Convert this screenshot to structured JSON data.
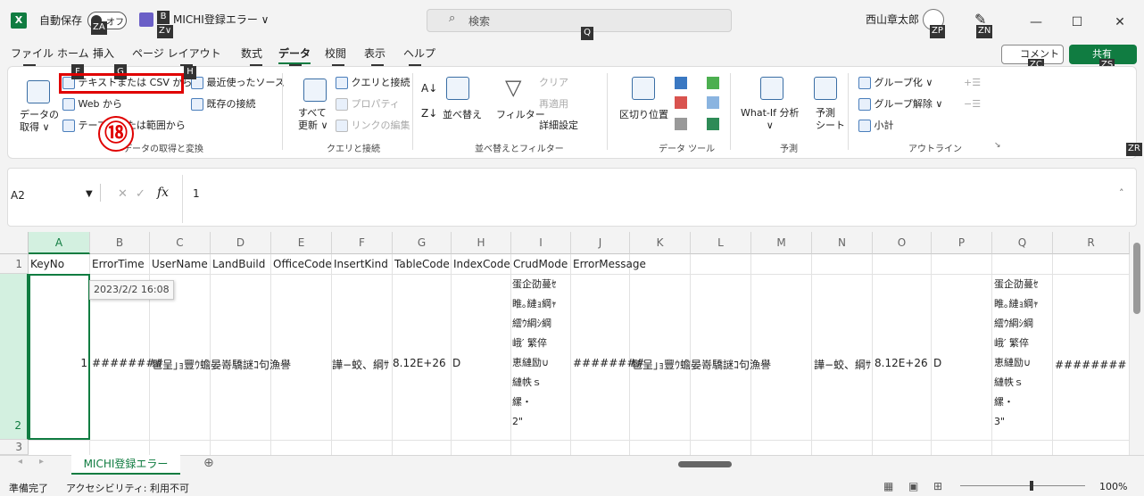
{
  "titlebar": {
    "excel_icon": "X",
    "autosave_label": "自動保存",
    "autosave_state": "オフ",
    "doc_title": "MICHI登録エラー ∨",
    "search_placeholder": "検索",
    "user_name": "西山章太郎",
    "keytips": {
      "autosave": "ZA",
      "save": "B",
      "save_sub": "Z∨",
      "search": "Q",
      "profile": "ZP",
      "pen": "ZN",
      "comment": "ZC",
      "share": "ZS",
      "ribbon_options": "ZR"
    },
    "minimize": "—",
    "maximize": "☐",
    "close": "✕"
  },
  "menu": {
    "tabs": [
      "ファイル",
      "ホーム",
      "挿入",
      "ページ レイアウト",
      "数式",
      "データ",
      "校閲",
      "表示",
      "ヘルプ"
    ],
    "keytips": [
      "F",
      "H",
      "N",
      "P",
      "M",
      "A",
      "R",
      "W",
      "Y"
    ],
    "comment_button": "コメント",
    "share_button": "共有"
  },
  "ribbon": {
    "get_data": "データの\n取得 ∨",
    "from_text_csv": "テキストまたは CSV から",
    "from_web": "Web から",
    "from_table": "テーブルまたは範囲から",
    "recent_sources": "最近使ったソース",
    "existing_connections": "既存の接続",
    "group_get_transform": "データの取得と変換",
    "refresh_all": "すべて\n更新 ∨",
    "queries_connections": "クエリと接続",
    "properties": "プロパティ",
    "edit_links": "リンクの編集",
    "group_queries": "クエリと接続",
    "sort": "並べ替え",
    "filter": "フィルター",
    "clear": "クリア",
    "reapply": "再適用",
    "advanced": "詳細設定",
    "group_sort_filter": "並べ替えとフィルター",
    "text_to_columns": "区切り位置",
    "group_data_tools": "データ ツール",
    "what_if": "What-If 分析\n∨",
    "forecast_sheet": "予測\nシート",
    "group_forecast": "予測",
    "group_outline_btn": "グループ化 ∨",
    "ungroup": "グループ解除 ∨",
    "subtotal": "小計",
    "group_outline": "アウトライン",
    "step_marker": "⑱",
    "keytip_hidden": [
      "F",
      "G",
      "H",
      "I"
    ]
  },
  "formula_bar": {
    "name_box": "A2",
    "cancel": "✕",
    "enter": "✓",
    "fx": "fx",
    "value": "1"
  },
  "grid": {
    "columns": [
      "A",
      "B",
      "C",
      "D",
      "E",
      "F",
      "G",
      "H",
      "I",
      "J",
      "K",
      "L",
      "M",
      "N",
      "O",
      "P",
      "Q",
      "R"
    ],
    "row_numbers": [
      "1",
      "2",
      "3"
    ],
    "headers_row1": [
      "KeyNo",
      "ErrorTime",
      "UserName",
      "LandBuild",
      "OfficeCode",
      "InsertKind",
      "TableCode",
      "IndexCode",
      "CrudMode",
      "ErrorMessage"
    ],
    "row2": {
      "a": "1",
      "b": "########",
      "c": "髱呈｣ｮ豐ｳ蟾晏嵜驕謎ｺ句漁譽",
      "f": "譁−蛟、綱ｻ",
      "g": "8.12E+26",
      "h": "D",
      "i_lines": "蛋企劭蔓ｾ\n睢｡縺ｮ綱ｬ\n繧ｳ綱ｼ綱\n峨′ 繁倅\n恵縺励∪\n縺帙ｓ\n縲・\n2\"",
      "j": "########",
      "k": "髱呈｣ｮ豐ｳ蟾晏嵜驕謎ｺ句漁譽",
      "n": "譁−蛟、綱ｻ",
      "o": "8.12E+26",
      "p": "D",
      "q_lines": "蛋企劭蔓ｾ\n睢｡縺ｮ綱ｬ\n繧ｳ綱ｼ綱\n峨′ 繁倅\n恵縺励∪\n縺帙ｓ\n縲・\n3\"",
      "r": "######## 髱"
    },
    "tooltip": "2023/2/2 16:08"
  },
  "sheets": {
    "active": "MICHI登録エラー",
    "add": "⊕"
  },
  "status": {
    "ready": "準備完了",
    "accessibility": "アクセシビリティ: 利用不可",
    "zoom": "100%"
  },
  "colors": {
    "accent": "#107c41",
    "highlight": "#e00000"
  }
}
